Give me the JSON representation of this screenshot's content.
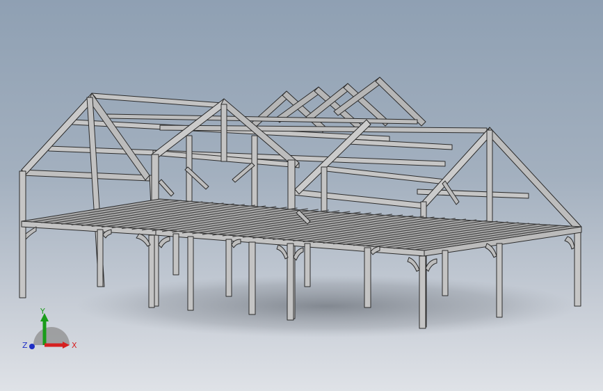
{
  "viewport": {
    "background_top": "#8fa0b3",
    "background_bottom": "#dfe2e7",
    "model_color": "#b9b9b9"
  },
  "triad": {
    "x_label": "X",
    "y_label": "Y",
    "z_label": "Z",
    "x_color": "#d62020",
    "y_color": "#1a9c1a",
    "z_color": "#1f2fc4"
  }
}
